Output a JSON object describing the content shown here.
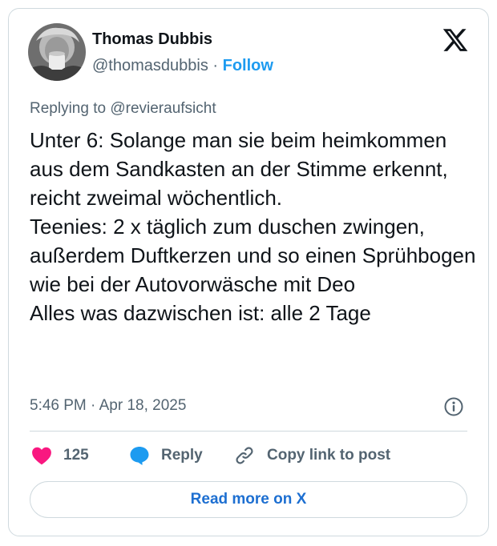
{
  "author": {
    "name": "Thomas Dubbis",
    "handle": "@thomasdubbis",
    "separator": "·",
    "follow_label": "Follow"
  },
  "reply_to": "Replying to @revieraufsicht",
  "tweet_text": "Unter 6: Solange man sie beim heimkommen aus dem Sandkasten an der Stimme erkennt, reicht zweimal wöchentlich.\nTeenies: 2 x täglich zum duschen zwingen, außerdem Duftkerzen und so einen Sprühbogen wie bei der Autovorwäsche mit Deo\nAlles was dazwischen ist: alle 2 Tage",
  "timestamp": "5:46 PM · Apr 18, 2025",
  "actions": {
    "like_count": "125",
    "reply_label": "Reply",
    "copy_label": "Copy link to post"
  },
  "read_more_label": "Read more on X",
  "colors": {
    "accent_blue": "#1d9bf0",
    "like_pink": "#f91880",
    "text_primary": "#0f1419",
    "text_secondary": "#536471",
    "border": "#cfd9de"
  },
  "icons": [
    "x-logo-icon",
    "info-icon",
    "heart-icon",
    "reply-bubble-icon",
    "link-icon"
  ]
}
